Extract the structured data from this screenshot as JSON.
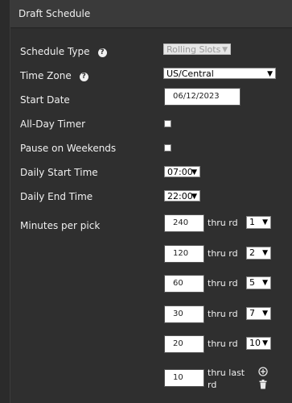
{
  "panel": {
    "title": "Draft Schedule"
  },
  "fields": {
    "schedule_type": {
      "label": "Schedule Type",
      "value": "Rolling Slots"
    },
    "time_zone": {
      "label": "Time Zone",
      "value": "US/Central"
    },
    "start_date": {
      "label": "Start Date",
      "value": "06/12/2023"
    },
    "all_day_timer": {
      "label": "All-Day Timer",
      "checked": false
    },
    "pause_weekends": {
      "label": "Pause on Weekends",
      "checked": false
    },
    "daily_start": {
      "label": "Daily Start Time",
      "value": "07:00"
    },
    "daily_end": {
      "label": "Daily End Time",
      "value": "22:00"
    },
    "minutes_per_pick": {
      "label": "Minutes per pick"
    }
  },
  "pick_rows": [
    {
      "minutes": "240",
      "thru": "thru rd",
      "round": "1"
    },
    {
      "minutes": "120",
      "thru": "thru rd",
      "round": "2"
    },
    {
      "minutes": "60",
      "thru": "thru rd",
      "round": "5"
    },
    {
      "minutes": "30",
      "thru": "thru rd",
      "round": "7"
    },
    {
      "minutes": "20",
      "thru": "thru rd",
      "round": "10"
    }
  ],
  "last_row": {
    "minutes": "10",
    "thru_line1": "thru last",
    "thru_line2": "rd"
  },
  "icons": {
    "help": "question-circle-icon",
    "add": "plus-circle-icon",
    "delete": "trash-icon"
  }
}
